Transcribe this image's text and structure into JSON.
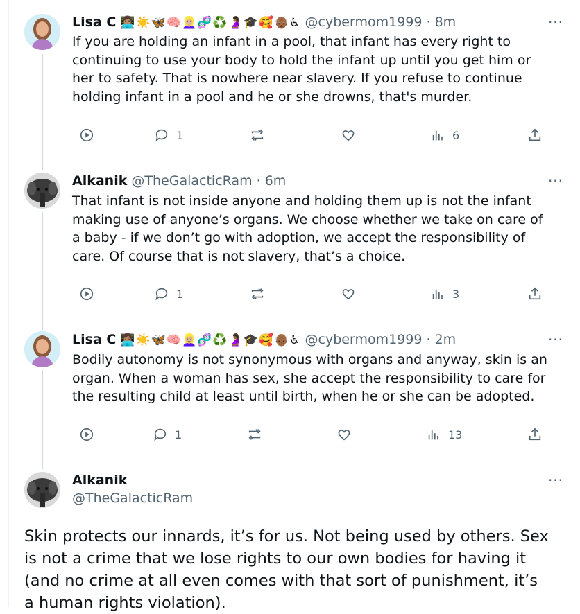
{
  "tweets": [
    {
      "name": "Lisa C",
      "emojis": [
        "👩🏽‍💻",
        "☀️",
        "🦋",
        "🧠",
        "👱🏼‍♀️",
        "🧬",
        "♻️",
        "🤰🏾",
        "🎓",
        "🥰",
        "👴🏾",
        "♿"
      ],
      "handle": "@cybermom1999",
      "time": "· 8m",
      "text": "If you are holding an infant in a pool, that infant has every right to continuing to use your body to hold the infant up until you get him or her to safety. That is nowhere near slavery. If you refuse to continue holding infant in a pool and he or she drowns, that's murder.",
      "replies": "1",
      "retweets": "",
      "likes": "",
      "views": "6"
    },
    {
      "name": "Alkanik",
      "handle": "@TheGalacticRam",
      "time": "· 6m",
      "text": "That infant is not inside anyone and holding them up is not the infant making use of anyone’s organs. We choose whether we take on care of a baby - if we don’t go with adoption, we accept the responsibility of care. Of course that is not slavery, that’s a choice.",
      "replies": "1",
      "retweets": "",
      "likes": "",
      "views": "3"
    },
    {
      "name": "Lisa C",
      "emojis": [
        "👩🏽‍💻",
        "☀️",
        "🦋",
        "🧠",
        "👱🏼‍♀️",
        "🧬",
        "♻️",
        "🤰🏾",
        "🎓",
        "🥰",
        "👴🏾",
        "♿"
      ],
      "handle": "@cybermom1999",
      "time": "· 2m",
      "text": "Bodily autonomy is not synonymous with organs and anyway, skin is an organ. When a woman has sex, she accept the responsibility to care for the resulting child at least until birth, when he or she can be adopted.",
      "replies": "1",
      "retweets": "",
      "likes": "",
      "views": "13"
    }
  ],
  "focused": {
    "name": "Alkanik",
    "handle": "@TheGalacticRam",
    "text": "Skin protects our innards, it’s for us. Not being used by others. Sex is not a crime that we lose rights to our own bodies for having it (and no crime at all even comes with that sort of punishment, it’s a human rights violation)."
  },
  "more_label": "···",
  "colors": {
    "text": "#0f1419",
    "secondary": "#536471",
    "thread": "#cfd9de"
  }
}
